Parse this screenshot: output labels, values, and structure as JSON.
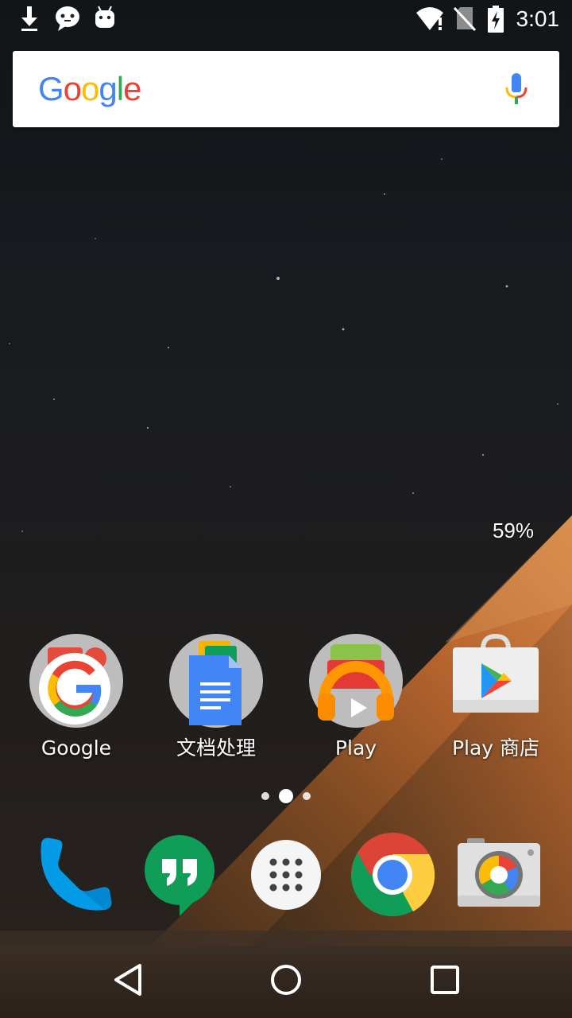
{
  "status_bar": {
    "time": "3:01",
    "icons": [
      "download-icon",
      "messenger-icon",
      "android-icon",
      "wifi-alert-icon",
      "no-sim-icon",
      "battery-charging-icon"
    ]
  },
  "search": {
    "logo_text": "Google",
    "logo_colors": [
      "#4285F4",
      "#EA4335",
      "#FBBC05",
      "#4285F4",
      "#34A853",
      "#EA4335"
    ],
    "mic_icon": "mic-icon"
  },
  "battery_widget": {
    "percent": "59%"
  },
  "home_apps": [
    {
      "label": "Google",
      "icon": "google-folder-icon"
    },
    {
      "label": "文档处理",
      "icon": "docs-folder-icon"
    },
    {
      "label": "Play",
      "icon": "play-folder-icon"
    },
    {
      "label": "Play 商店",
      "icon": "play-store-icon"
    }
  ],
  "page_indicator": {
    "pages": 3,
    "active": 2
  },
  "dock": [
    {
      "name": "phone",
      "icon": "phone-icon"
    },
    {
      "name": "hangouts",
      "icon": "hangouts-icon"
    },
    {
      "name": "app-drawer",
      "icon": "app-drawer-icon"
    },
    {
      "name": "chrome",
      "icon": "chrome-icon"
    },
    {
      "name": "camera",
      "icon": "camera-icon"
    }
  ],
  "nav_bar": {
    "buttons": [
      "back-icon",
      "home-icon",
      "recents-icon"
    ]
  }
}
